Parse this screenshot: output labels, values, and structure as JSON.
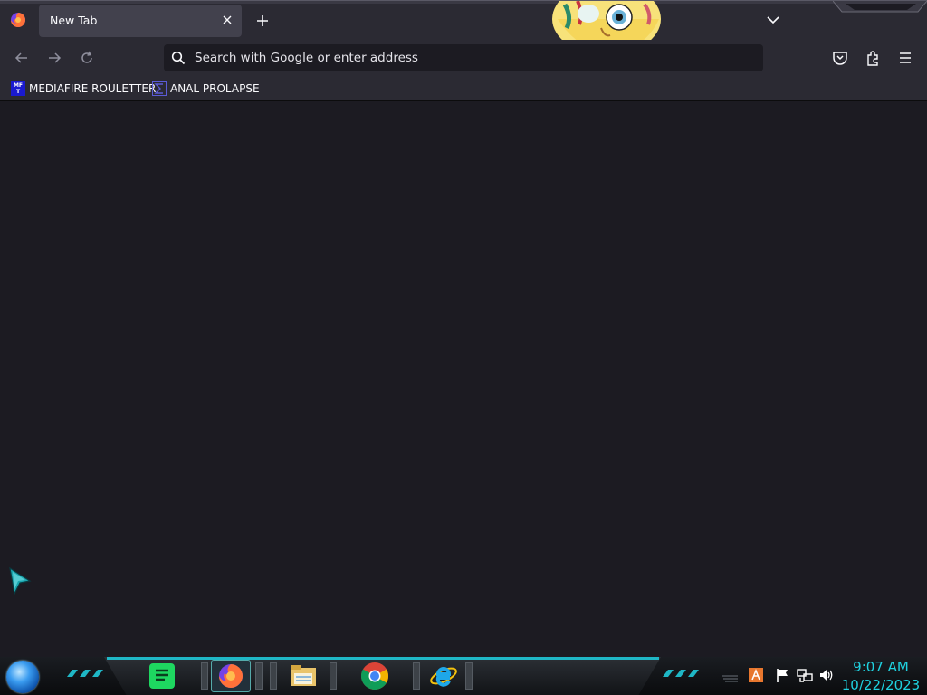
{
  "browser": {
    "tab": {
      "title": "New Tab"
    },
    "urlbar": {
      "placeholder": "Search with Google or enter address"
    },
    "bookmarks": [
      {
        "label": "MEDIAFIRE ROULETTER",
        "icon": "mediafire-icon",
        "icon_text": "MF T"
      },
      {
        "label": "ANAL PROLAPSE",
        "icon": "sigma-bookmark-icon"
      }
    ],
    "toolbar_icons": [
      "back-icon",
      "forward-icon",
      "reload-icon",
      "pocket-icon",
      "extensions-icon",
      "menu-icon"
    ]
  },
  "taskbar": {
    "pinned_apps": [
      "spotify-icon",
      "firefox-icon",
      "file-explorer-icon",
      "chrome-icon",
      "internet-explorer-icon"
    ],
    "active_app": "firefox-icon",
    "tray_icons": [
      "language-icon",
      "flag-icon",
      "network-icon",
      "volume-icon"
    ],
    "clock": {
      "time": "9:07 AM",
      "date": "10/22/2023"
    }
  },
  "colors": {
    "toolbar_bg": "#2b2a33",
    "content_bg": "#1c1b22",
    "tab_active_bg": "#42414d",
    "clock_color": "#1fd2e0",
    "taskbar_accent": "#1fb7c6"
  }
}
